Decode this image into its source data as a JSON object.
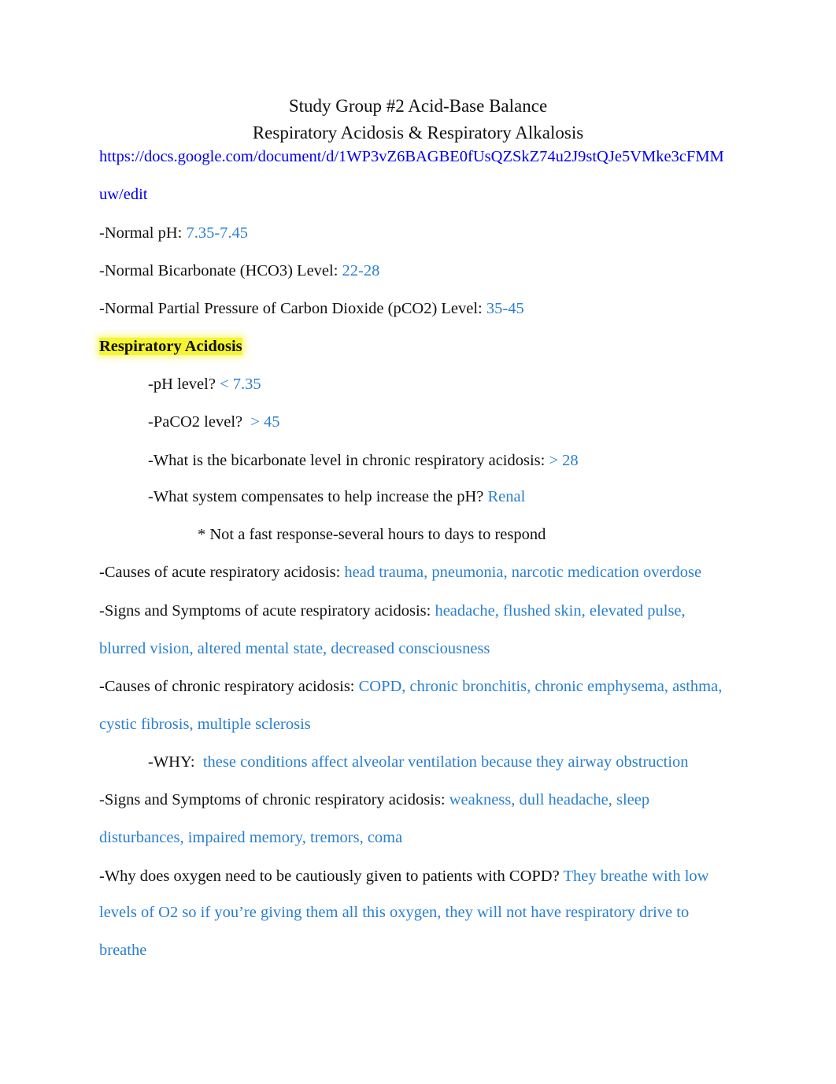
{
  "title": "Study Group #2 Acid-Base Balance",
  "subtitle": "Respiratory Acidosis & Respiratory Alkalosis",
  "link": {
    "line1": "https://docs.google.com/document/d/1WP3vZ6BAGBE0fUsQZSkZ74u2J9stQJe5VMke3cFMM",
    "line2": "uw/edit"
  },
  "normals": {
    "ph": {
      "label": "-Normal pH: ",
      "value": "7.35-7.45"
    },
    "hco3": {
      "label": "-Normal Bicarbonate (HCO3) Level: ",
      "value": "22-28"
    },
    "pco2": {
      "label": "-Normal Partial Pressure of Carbon Dioxide (pCO2) Level: ",
      "value": "35-45"
    }
  },
  "section_heading": "Respiratory Acidosis",
  "qa": [
    {
      "q": "-pH level? ",
      "a": "< 7.35"
    },
    {
      "q": "-PaCO2 level?  ",
      "a": "> 45"
    },
    {
      "q": "-What is the bicarbonate level in chronic respiratory acidosis: ",
      "a": "> 28"
    },
    {
      "q": "-What system compensates to help increase the pH? ",
      "a": "Renal"
    }
  ],
  "note": "* Not a fast response-several hours to days to respond",
  "acute_causes": {
    "q": "-Causes of acute respiratory acidosis: ",
    "a": "head trauma, pneumonia, narcotic medication overdose"
  },
  "acute_signs": {
    "q": "-Signs and Symptoms of acute respiratory acidosis: ",
    "a1": "headache, flushed skin, elevated pulse,",
    "a2": "blurred vision, altered mental state, decreased consciousness"
  },
  "chronic_causes": {
    "q": "-Causes of chronic respiratory acidosis: ",
    "a1": "COPD, chronic bronchitis, chronic emphysema, asthma,",
    "a2": "cystic fibrosis, multiple sclerosis"
  },
  "why": {
    "q": "-WHY:  ",
    "a": "these conditions affect alveolar ventilation because they airway obstruction"
  },
  "chronic_signs": {
    "q": "-Signs and Symptoms of chronic respiratory acidosis: ",
    "a1": "weakness, dull headache, sleep",
    "a2": "disturbances, impaired memory, tremors, coma"
  },
  "copd": {
    "q": "-Why does oxygen need to be cautiously given to patients with COPD? ",
    "a1": "They breathe with low",
    "a2": "levels of O2 so if you’re giving them all this oxygen, they will not have respiratory drive to",
    "a3": "breathe"
  },
  "colors": {
    "answer": "#2a7fcf",
    "link": "#0000ee",
    "highlight": "#f5f533"
  }
}
